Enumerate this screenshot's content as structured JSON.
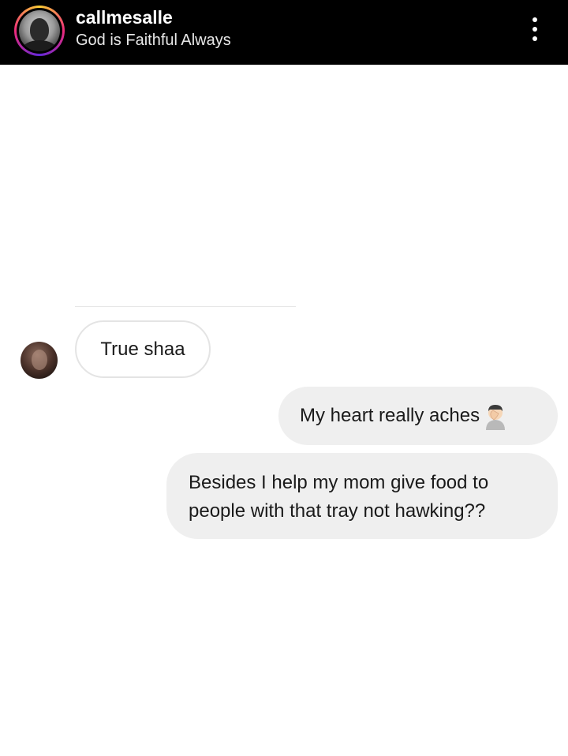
{
  "header": {
    "username": "callmesalle",
    "status": "God is Faithful Always",
    "menu_icon": "more-vertical-icon"
  },
  "messages": [
    {
      "sender": "other",
      "text": "True shaa"
    },
    {
      "sender": "me",
      "text": "My heart really aches",
      "emoji": "person-facepalming-emoji"
    },
    {
      "sender": "me",
      "text": "Besides I help my mom give food to people with that tray not hawking??"
    }
  ],
  "colors": {
    "header_bg": "#000000",
    "outgoing_bubble": "#efefef",
    "incoming_border": "#e4e4e4"
  }
}
